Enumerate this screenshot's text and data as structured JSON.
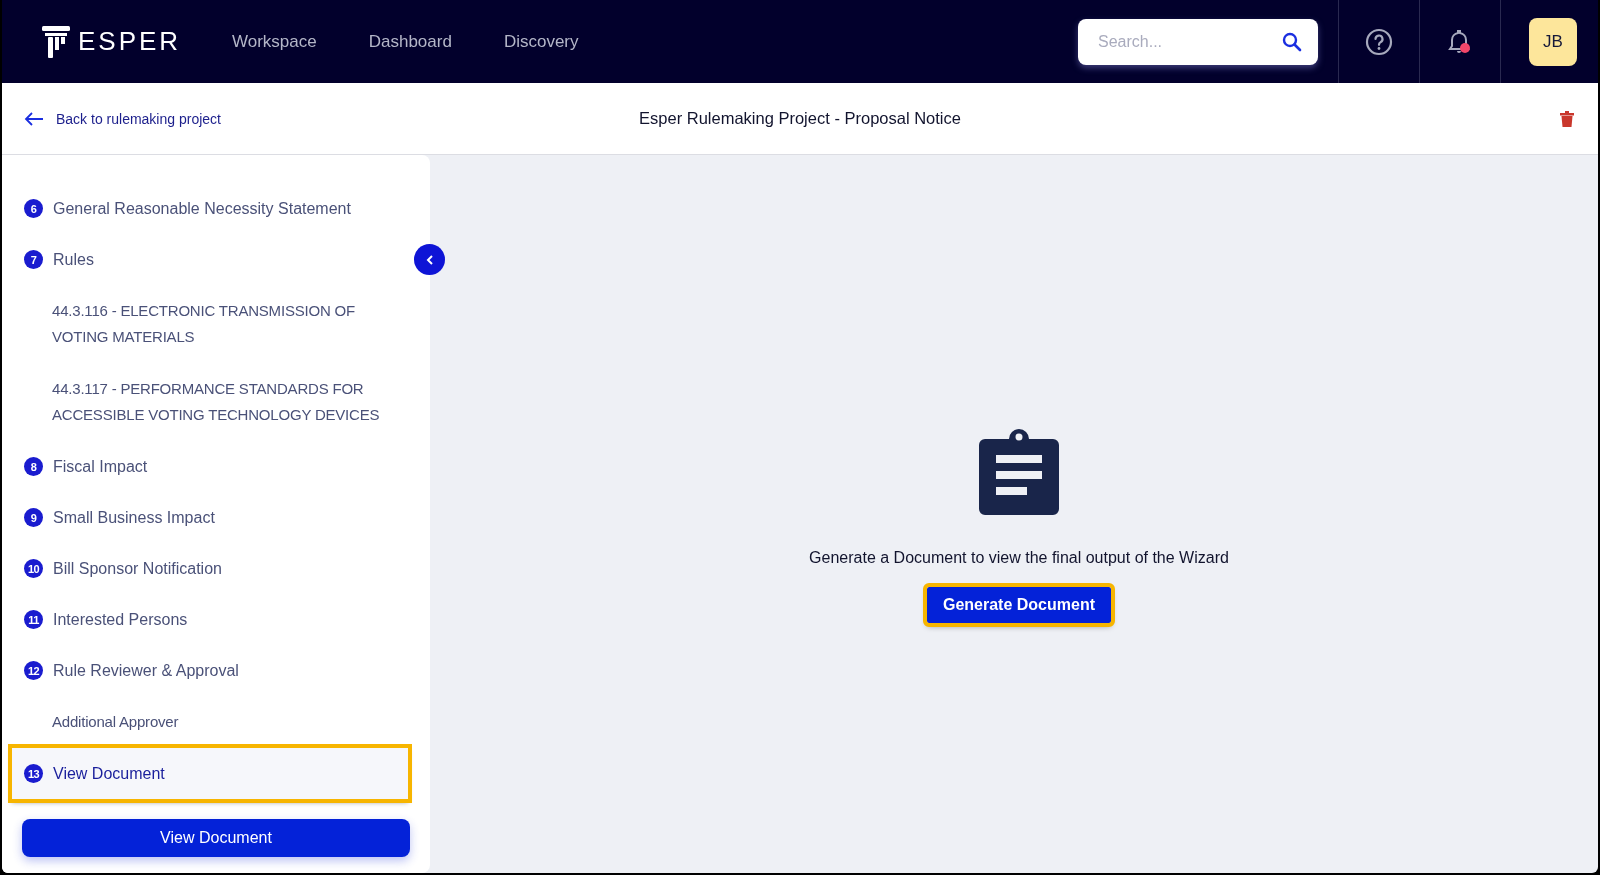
{
  "header": {
    "logo": "ESPER",
    "nav": [
      {
        "label": "Workspace",
        "selected": false
      },
      {
        "label": "Dashboard",
        "selected": false
      },
      {
        "label": "Discovery",
        "selected": false
      }
    ],
    "search": {
      "placeholder": "Search..."
    },
    "notifications": {
      "unread": true
    },
    "avatar": {
      "initials": "JB"
    }
  },
  "subheader": {
    "back_link": "Back to rulemaking project",
    "title": "Esper Rulemaking Project - Proposal Notice"
  },
  "sidebar": {
    "items": [
      {
        "kind": "step",
        "number": "6",
        "label": "General Reasonable Necessity Statement",
        "selected": false,
        "highlighted": false
      },
      {
        "kind": "step",
        "number": "7",
        "label": "Rules",
        "selected": false,
        "highlighted": false
      },
      {
        "kind": "sub",
        "label": "44.3.116 - ELECTRONIC TRANSMISSION OF VOTING MATERIALS",
        "selected": false,
        "highlighted": false
      },
      {
        "kind": "sub",
        "label": "44.3.117 - PERFORMANCE STANDARDS FOR ACCESSIBLE VOTING TECHNOLOGY DEVICES",
        "selected": false,
        "highlighted": false
      },
      {
        "kind": "step",
        "number": "8",
        "label": "Fiscal Impact",
        "selected": false,
        "highlighted": false
      },
      {
        "kind": "step",
        "number": "9",
        "label": "Small Business Impact",
        "selected": false,
        "highlighted": false
      },
      {
        "kind": "step",
        "number": "10",
        "label": "Bill Sponsor Notification",
        "selected": false,
        "highlighted": false
      },
      {
        "kind": "step",
        "number": "11",
        "label": "Interested Persons",
        "selected": false,
        "highlighted": false
      },
      {
        "kind": "step",
        "number": "12",
        "label": "Rule Reviewer & Approval",
        "selected": false,
        "highlighted": false
      },
      {
        "kind": "sub",
        "label": "Additional Approver",
        "selected": false,
        "highlighted": false
      },
      {
        "kind": "step",
        "number": "13",
        "label": "View Document",
        "selected": true,
        "highlighted": true
      }
    ],
    "button": "View Document"
  },
  "main": {
    "message": "Generate a Document to view the final output of the Wizard",
    "button": {
      "label": "Generate Document",
      "highlighted": true
    }
  }
}
